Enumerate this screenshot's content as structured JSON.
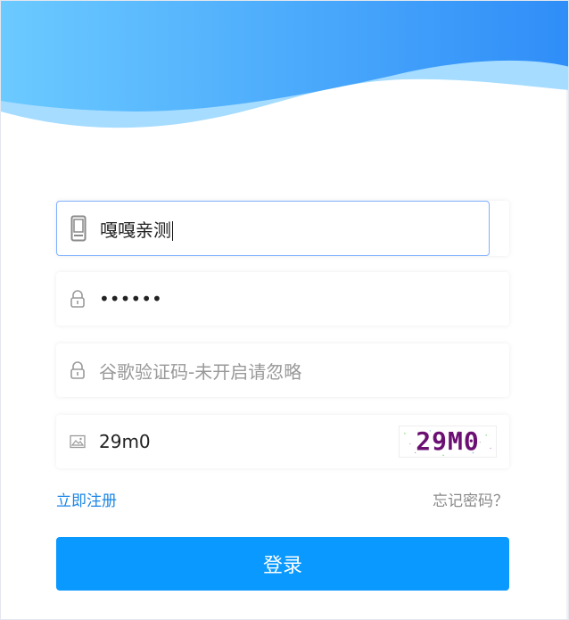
{
  "form": {
    "phone": {
      "value": "嘎嘎亲测",
      "icon": "phone-icon"
    },
    "password": {
      "value": "••••••",
      "icon": "lock-icon"
    },
    "google_code": {
      "placeholder": "谷歌验证码-未开启请忽略",
      "icon": "lock-icon"
    },
    "captcha": {
      "value": "29m0",
      "image_text": "29M0",
      "icon": "image-icon"
    }
  },
  "links": {
    "register": "立即注册",
    "forgot": "忘记密码？"
  },
  "buttons": {
    "login": "登录"
  },
  "colors": {
    "primary": "#0a99ff",
    "link_blue": "#1a86e6",
    "wave_light": "#9bd8ff",
    "wave_dark": "#2f8df8",
    "captcha_text": "#6b0f73"
  }
}
